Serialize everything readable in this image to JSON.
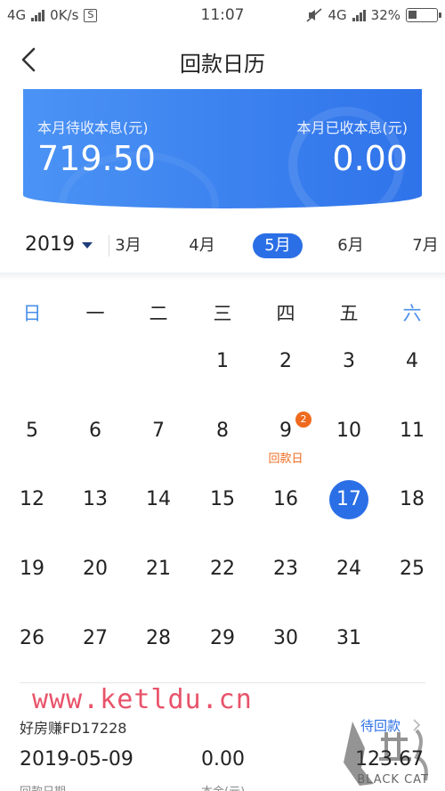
{
  "status_bar": {
    "network_left": "4G",
    "speed": "0K/s",
    "s_icon": "S",
    "time": "11:07",
    "network_right": "4G",
    "battery_pct": "32%",
    "battery_level": 0.32
  },
  "header": {
    "back_icon": "chevron-left-icon",
    "title": "回款日历"
  },
  "summary": {
    "pending_label": "本月待收本息(元)",
    "pending_value": "719.50",
    "received_label": "本月已收本息(元)",
    "received_value": "0.00",
    "accent": "#2f73ea"
  },
  "month_bar": {
    "year": "2019",
    "months": [
      "3月",
      "4月",
      "5月",
      "6月",
      "7月"
    ],
    "active_month": "5月"
  },
  "calendar": {
    "weekdays": [
      "日",
      "一",
      "二",
      "三",
      "四",
      "五",
      "六"
    ],
    "weeks": [
      [
        "",
        "",
        "",
        "1",
        "2",
        "3",
        "4"
      ],
      [
        "5",
        "6",
        "7",
        "8",
        "9",
        "10",
        "11"
      ],
      [
        "12",
        "13",
        "14",
        "15",
        "16",
        "17",
        "18"
      ],
      [
        "19",
        "20",
        "21",
        "22",
        "23",
        "24",
        "25"
      ],
      [
        "26",
        "27",
        "28",
        "29",
        "30",
        "31",
        ""
      ]
    ],
    "today": "17",
    "repay_day": "9",
    "repay_badge": "2",
    "repay_label": "回款日"
  },
  "watermark": "www.ketldu.cn",
  "loan": {
    "name": "好房赚FD17228",
    "status": "待回款",
    "date": "2019-05-09",
    "value_mid": "0.00",
    "value_right": "123.67",
    "sub_left": "回款日期",
    "sub_mid": "本金(元)"
  },
  "logo_text": "BLACK CAT",
  "colors": {
    "blue": "#2b6fe6",
    "orange": "#ef6a1e",
    "weekend": "#4a8fe8"
  }
}
